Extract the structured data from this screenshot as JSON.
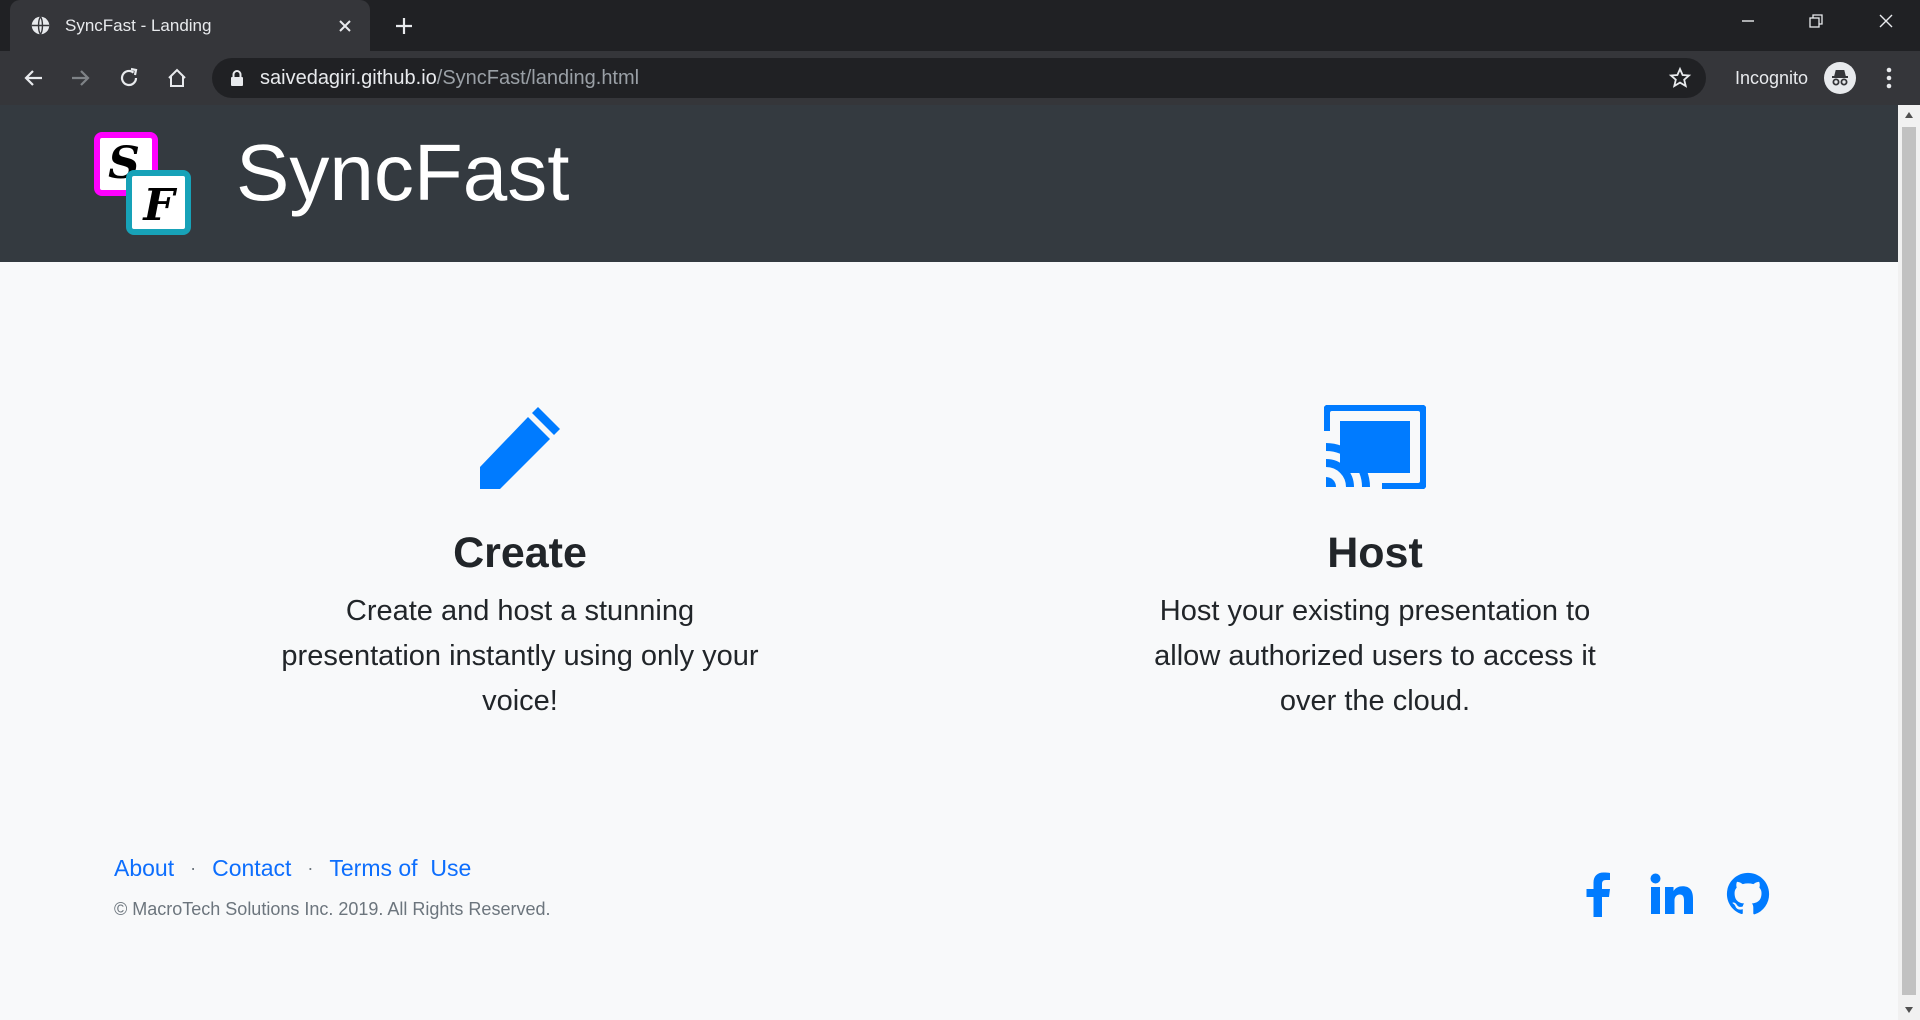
{
  "browser": {
    "tab_title": "SyncFast - Landing",
    "url_host": "saivedagiri.github.io",
    "url_path": "/SyncFast/landing.html",
    "incognito_label": "Incognito"
  },
  "header": {
    "brand": "SyncFast",
    "logo_letters": [
      "S",
      "F"
    ]
  },
  "features": [
    {
      "icon": "pencil-icon",
      "title": "Create",
      "description": "Create and host a stunning presentation instantly using only your voice!"
    },
    {
      "icon": "cast-icon",
      "title": "Host",
      "description": "Host your existing presentation to allow authorized users to access it over the cloud."
    }
  ],
  "footer": {
    "links": [
      "About",
      "Contact",
      "Terms of  Use"
    ],
    "separator": "·",
    "copyright": "© MacroTech Solutions Inc. 2019. All Rights Reserved.",
    "social": [
      "facebook-icon",
      "linkedin-icon",
      "github-icon"
    ]
  },
  "colors": {
    "header_bg": "#343a40",
    "accent": "#007bff",
    "logo_magenta": "#ff00ff",
    "logo_cyan": "#17a2b8"
  }
}
